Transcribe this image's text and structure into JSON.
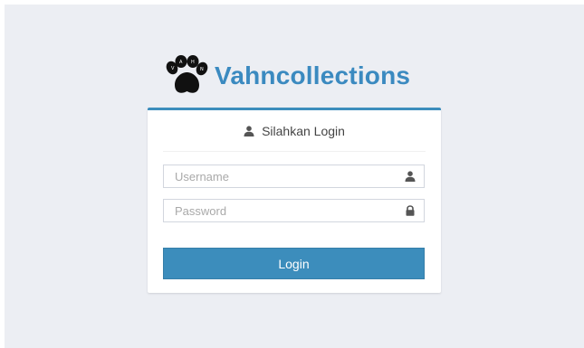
{
  "brand": {
    "name": "Vahncollections",
    "logo_icon": "paw-print-icon",
    "color": "#3b8ac0"
  },
  "login_box": {
    "header_icon": "user-icon",
    "header_text": "Silahkan Login",
    "accent_color": "#3c8dbc",
    "username": {
      "placeholder": "Username",
      "value": "",
      "icon": "user-icon"
    },
    "password": {
      "placeholder": "Password",
      "value": "",
      "icon": "lock-icon"
    },
    "submit_label": "Login"
  }
}
